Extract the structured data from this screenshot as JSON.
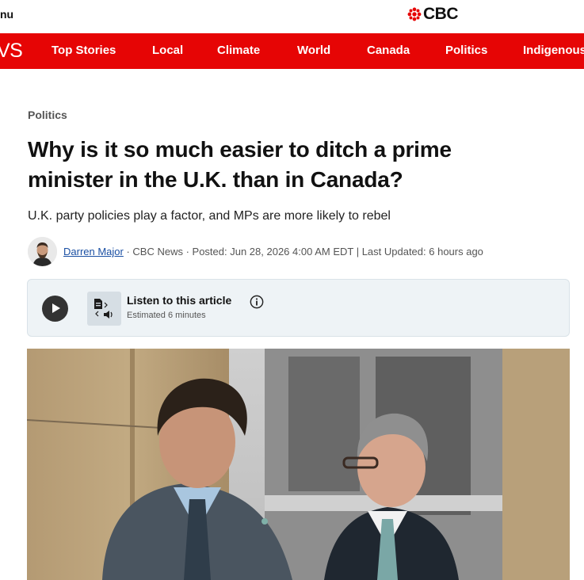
{
  "header": {
    "menu_label": "nu",
    "logo_text": "CBC"
  },
  "nav": {
    "brand": "VS",
    "items": [
      "Top Stories",
      "Local",
      "Climate",
      "World",
      "Canada",
      "Politics",
      "Indigenous"
    ]
  },
  "article": {
    "section": "Politics",
    "headline": "Why is it so much easier to ditch a prime minister in the U.K. than in Canada?",
    "deck": "U.K. party policies play a factor, and MPs are more likely to rebel",
    "byline": {
      "author": "Darren Major",
      "meta": " · CBC News · Posted: Jun 28, 2026 4:00 AM EDT | Last Updated: 6 hours ago"
    }
  },
  "listen": {
    "title": "Listen to this article",
    "subtitle": "Estimated 6 minutes"
  },
  "colors": {
    "brand_red": "#e60505"
  }
}
